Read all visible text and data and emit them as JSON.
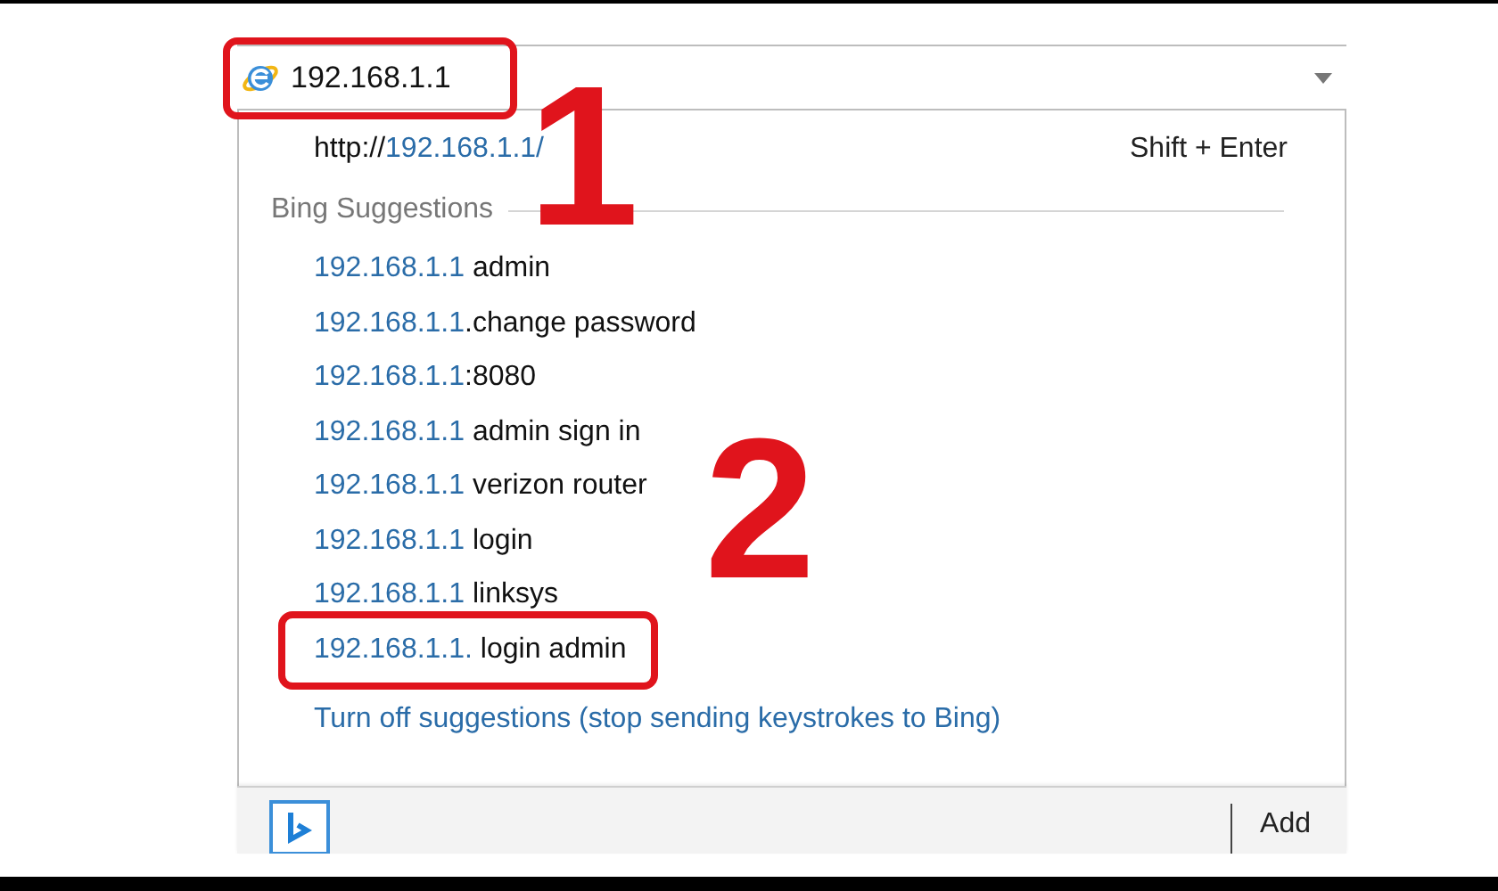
{
  "address_bar": {
    "value": "192.168.1.1",
    "boxed": true
  },
  "direct_entry": {
    "scheme": "http://",
    "host": "192.168.1.1/",
    "shortcut": "Shift + Enter"
  },
  "section_title": "Bing Suggestions",
  "suggestions": [
    {
      "query": "192.168.1.1",
      "rest": " admin",
      "boxed": false
    },
    {
      "query": "192.168.1.1",
      "rest": ".change password",
      "boxed": false
    },
    {
      "query": "192.168.1.1",
      "rest": ":8080",
      "boxed": false
    },
    {
      "query": "192.168.1.1",
      "rest": " admin sign in",
      "boxed": false
    },
    {
      "query": "192.168.1.1",
      "rest": " verizon router",
      "boxed": false
    },
    {
      "query": "192.168.1.1",
      "rest": " login",
      "boxed": false
    },
    {
      "query": "192.168.1.1",
      "rest": " linksys",
      "boxed": false
    },
    {
      "query": "192.168.1.1.",
      "rest": " login admin",
      "boxed": true
    }
  ],
  "turn_off_link": "Turn off suggestions (stop sending keystrokes to Bing)",
  "footer": {
    "add_button": "Add"
  },
  "annotations": [
    {
      "label": "1"
    },
    {
      "label": "2"
    }
  ]
}
